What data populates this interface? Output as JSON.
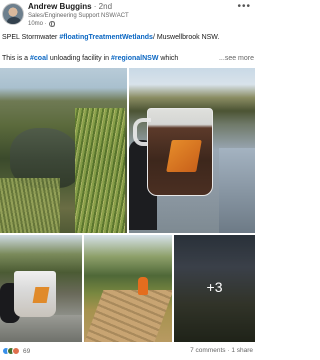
{
  "author": {
    "name": "Andrew Buggins",
    "degree": "· 2nd",
    "headline": "Sales/Engineering Support NSW/ACT",
    "time": "10mo ·"
  },
  "menu_glyph": "•••",
  "post": {
    "line1": {
      "pre": "SPEL Stormwater ",
      "tag": "#floatingTreatmentWetlands",
      "post": "/ Muswellbrook NSW."
    },
    "line2": {
      "pre": "This is a ",
      "tag1": "#coal",
      "mid": " unloading facility in ",
      "tag2": "#regionalNSW",
      "post": " which",
      "see_more": "...see more"
    }
  },
  "images": {
    "more_count": "+3"
  },
  "footer": {
    "reactions_count": "69",
    "comments": "7 comments",
    "separator": " · ",
    "shares": "1 share"
  },
  "colors": {
    "hashtag": "#0a66c2",
    "like": "#378fe9",
    "celebrate": "#44712e",
    "love": "#df704d"
  },
  "icons": [
    "globe-icon",
    "more-options-icon",
    "like-reaction-icon",
    "celebrate-reaction-icon",
    "love-reaction-icon"
  ]
}
